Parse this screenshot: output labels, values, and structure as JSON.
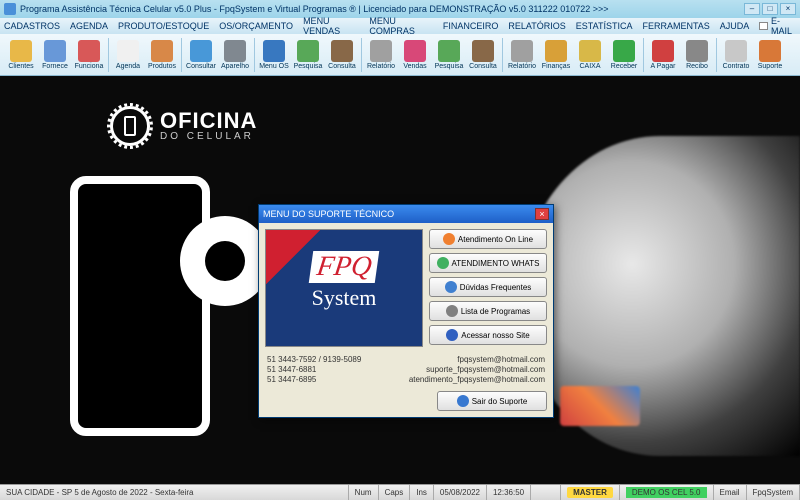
{
  "titlebar": {
    "title": "Programa Assistência Técnica Celular v5.0 Plus - FpqSystem e Virtual Programas ® | Licenciado para  DEMONSTRAÇÃO v5.0 311222 010722 >>>"
  },
  "menubar": {
    "items": [
      "CADASTROS",
      "AGENDA",
      "PRODUTO/ESTOQUE",
      "OS/ORÇAMENTO",
      "MENU VENDAS",
      "MENU COMPRAS",
      "FINANCEIRO",
      "RELATÓRIOS",
      "ESTATÍSTICA",
      "FERRAMENTAS",
      "AJUDA"
    ],
    "email": "E-MAIL"
  },
  "toolbar": {
    "items": [
      {
        "label": "Clientes",
        "color": "#e8b848"
      },
      {
        "label": "Fornece",
        "color": "#6898d8"
      },
      {
        "label": "Funciona",
        "color": "#d85858"
      },
      {
        "label": "Agenda",
        "color": "#f0f0f0"
      },
      {
        "label": "Produtos",
        "color": "#d88848"
      },
      {
        "label": "Consultar",
        "color": "#4898d8"
      },
      {
        "label": "Aparelho",
        "color": "#808890"
      },
      {
        "label": "Menu OS",
        "color": "#3878c0"
      },
      {
        "label": "Pesquisa",
        "color": "#58a858"
      },
      {
        "label": "Consulta",
        "color": "#886848"
      },
      {
        "label": "Relatório",
        "color": "#a0a0a0"
      },
      {
        "label": "Vendas",
        "color": "#d84878"
      },
      {
        "label": "Pesquisa",
        "color": "#58a858"
      },
      {
        "label": "Consulta",
        "color": "#886848"
      },
      {
        "label": "Relatório",
        "color": "#a0a0a0"
      },
      {
        "label": "Finanças",
        "color": "#d8a038"
      },
      {
        "label": "CAIXA",
        "color": "#d8b848"
      },
      {
        "label": "Receber",
        "color": "#38a848"
      },
      {
        "label": "A Pagar",
        "color": "#d04040"
      },
      {
        "label": "Recibo",
        "color": "#888888"
      },
      {
        "label": "Contrato",
        "color": "#c8c8c8"
      },
      {
        "label": "Suporte",
        "color": "#d87838"
      }
    ]
  },
  "bg": {
    "logo_big": "OFICINA",
    "logo_small": "DO CELULAR"
  },
  "dialog": {
    "title": "MENU DO SUPORTE TÉCNICO",
    "logo_top": "FPQ",
    "logo_bottom": "System",
    "buttons": [
      {
        "label": "Atendimento On Line",
        "icon": "#f08030"
      },
      {
        "label": "ATENDIMENTO WHATS",
        "icon": "#40b060"
      },
      {
        "label": "Dúvidas Frequentes",
        "icon": "#4080d0"
      },
      {
        "label": "Lista de Programas",
        "icon": "#808080"
      },
      {
        "label": "Acessar nosso Site",
        "icon": "#3060c0"
      }
    ],
    "exit": {
      "label": "Sair do Suporte",
      "icon": "#3878d0"
    },
    "contacts": [
      {
        "phone": "51 3443-7592 / 9139-5089",
        "email": "fpqsystem@hotmail.com"
      },
      {
        "phone": "51 3447-6881",
        "email": "suporte_fpqsystem@hotmail.com"
      },
      {
        "phone": "51 3447-6895",
        "email": "atendimento_fpqsystem@hotmail.com"
      }
    ]
  },
  "statusbar": {
    "location": "SUA CIDADE - SP  5 de Agosto de 2022 - Sexta-feira",
    "num": "Num",
    "caps": "Caps",
    "ins": "Ins",
    "date": "05/08/2022",
    "time": "12:36:50",
    "master": "MASTER",
    "demo": "DEMO OS CEL 5.0",
    "email": "Email",
    "brand": "FpqSystem"
  }
}
